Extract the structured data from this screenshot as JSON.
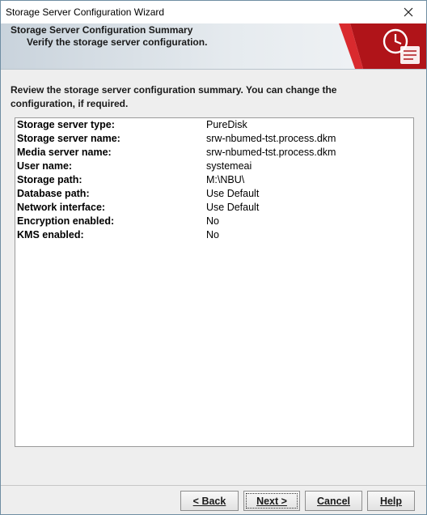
{
  "window": {
    "title": "Storage Server Configuration Wizard"
  },
  "banner": {
    "title": "Storage Server Configuration Summary",
    "subtitle": "Verify the storage server configuration."
  },
  "intro": {
    "line1": "Review the storage server configuration summary. You can change the",
    "line2": "configuration, if required."
  },
  "summary": {
    "rows": [
      {
        "label": "Storage server type:",
        "value": "PureDisk"
      },
      {
        "label": "Storage server name:",
        "value": "srw-nbumed-tst.process.dkm"
      },
      {
        "label": "Media server name:",
        "value": "srw-nbumed-tst.process.dkm"
      },
      {
        "label": "User name:",
        "value": "systemeai"
      },
      {
        "label": "Storage path:",
        "value": "M:\\NBU\\"
      },
      {
        "label": "Database path:",
        "value": "Use Default"
      },
      {
        "label": "Network interface:",
        "value": "Use Default"
      },
      {
        "label": "Encryption enabled:",
        "value": "No"
      },
      {
        "label": "KMS enabled:",
        "value": "No"
      }
    ]
  },
  "buttons": {
    "back": "< Back",
    "next": "Next >",
    "cancel": "Cancel",
    "help": "Help"
  },
  "icons": {
    "close": "close-icon",
    "wizard": "clock-scroll-icon"
  },
  "colors": {
    "accent_red": "#b01419",
    "border": "#6f8ea3"
  }
}
